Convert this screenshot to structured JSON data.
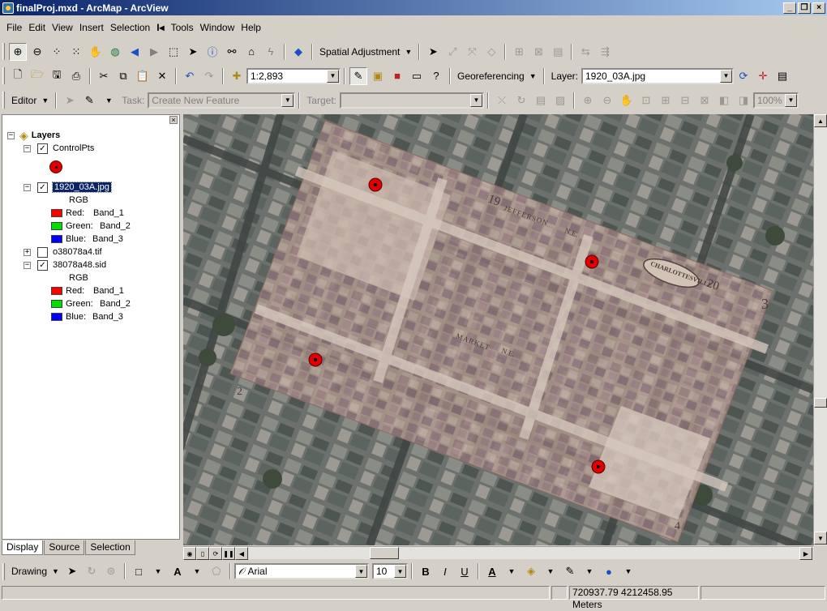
{
  "window": {
    "title": "finalProj.mxd - ArcMap - ArcView",
    "buttons": {
      "min": "_",
      "restore": "❐",
      "close": "×"
    }
  },
  "menu": [
    "File",
    "Edit",
    "View",
    "Insert",
    "Selection",
    "Tools",
    "Window",
    "Help"
  ],
  "toolbar1": {
    "spatial_adjustment": "Spatial Adjustment"
  },
  "toolbar2": {
    "scale": "1:2,893",
    "georeferencing": "Georeferencing",
    "layer_label": "Layer:",
    "layer_value": "1920_03A.jpg"
  },
  "toolbar3": {
    "editor": "Editor",
    "task_label": "Task:",
    "task_value": "Create New Feature",
    "target_label": "Target:",
    "target_value": "",
    "zoom_value": "100%"
  },
  "toc": {
    "root": "Layers",
    "layers": [
      {
        "name": "ControlPts",
        "checked": true
      },
      {
        "name": "1920_03A.jpg",
        "checked": true,
        "rgb": "RGB",
        "bands": [
          {
            "label": "Red:",
            "band": "Band_1",
            "color": "#ff0000"
          },
          {
            "label": "Green:",
            "band": "Band_2",
            "color": "#00e000"
          },
          {
            "label": "Blue:",
            "band": "Band_3",
            "color": "#0000ff"
          }
        ]
      },
      {
        "name": "o38078a4.tif",
        "checked": false
      },
      {
        "name": "38078a48.sid",
        "checked": true,
        "rgb": "RGB",
        "bands": [
          {
            "label": "Red:",
            "band": "Band_1",
            "color": "#ff0000"
          },
          {
            "label": "Green:",
            "band": "Band_2",
            "color": "#00e000"
          },
          {
            "label": "Blue:",
            "band": "Band_3",
            "color": "#0000ff"
          }
        ]
      }
    ],
    "tabs": [
      "Display",
      "Source",
      "Selection"
    ]
  },
  "map": {
    "labels": {
      "block_19": "19",
      "block_20": "20",
      "block_2": "2",
      "block_3": "3",
      "block_4": "4",
      "street_jefferson": "JEFFERSON",
      "street_market": "MARKET",
      "ne1": "N.E.",
      "ne2": "N.E.",
      "stamp": "CHARLOTTESVILLE"
    },
    "control_point_color": "#e00000"
  },
  "drawing": {
    "label": "Drawing",
    "font": "Arial",
    "size": "10"
  },
  "status": {
    "coords": "720937.79  4212458.95 Meters"
  }
}
